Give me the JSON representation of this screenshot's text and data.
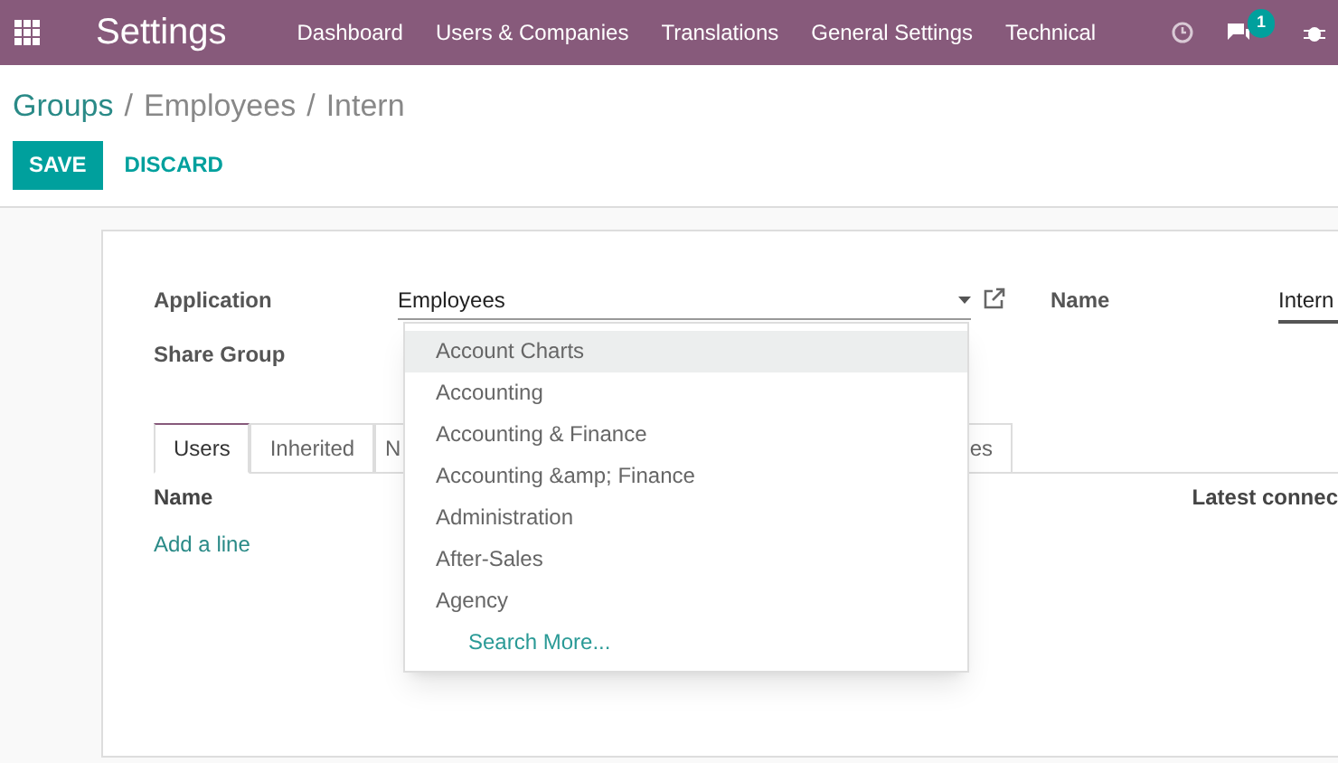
{
  "navbar": {
    "app_title": "Settings",
    "menu": [
      {
        "label": "Dashboard"
      },
      {
        "label": "Users & Companies"
      },
      {
        "label": "Translations"
      },
      {
        "label": "General Settings"
      },
      {
        "label": "Technical"
      }
    ],
    "message_count": "1"
  },
  "breadcrumb": [
    {
      "label": "Groups",
      "link": true
    },
    {
      "label": "Employees",
      "link": false
    },
    {
      "label": "Intern",
      "link": false
    }
  ],
  "breadcrumb_separators": [
    "/",
    "/"
  ],
  "buttons": [
    {
      "label": "SAVE",
      "kind": "primary"
    },
    {
      "label": "DISCARD",
      "kind": "link"
    }
  ],
  "form": {
    "application_label": "Application",
    "application_value": "Employees",
    "share_group_label": "Share Group",
    "name_label": "Name",
    "name_value": "Intern"
  },
  "tabs": [
    {
      "label": "Users",
      "selected": true
    },
    {
      "label": "Inherited",
      "selected": false
    },
    {
      "label": "N",
      "selected": false
    },
    {
      "label": "es",
      "selected": false
    }
  ],
  "table": {
    "columns": [
      "Name",
      "Latest connec"
    ],
    "add_line": "Add a line"
  },
  "dropdown": {
    "items": [
      {
        "label": "Account Charts",
        "selected": true
      },
      {
        "label": "Accounting",
        "selected": false
      },
      {
        "label": "Accounting & Finance",
        "selected": false
      },
      {
        "label": "Accounting &amp; Finance",
        "selected": false
      },
      {
        "label": "Administration",
        "selected": false
      },
      {
        "label": "After-Sales",
        "selected": false
      },
      {
        "label": "Agency",
        "selected": false
      }
    ],
    "search_more": "Search More..."
  }
}
